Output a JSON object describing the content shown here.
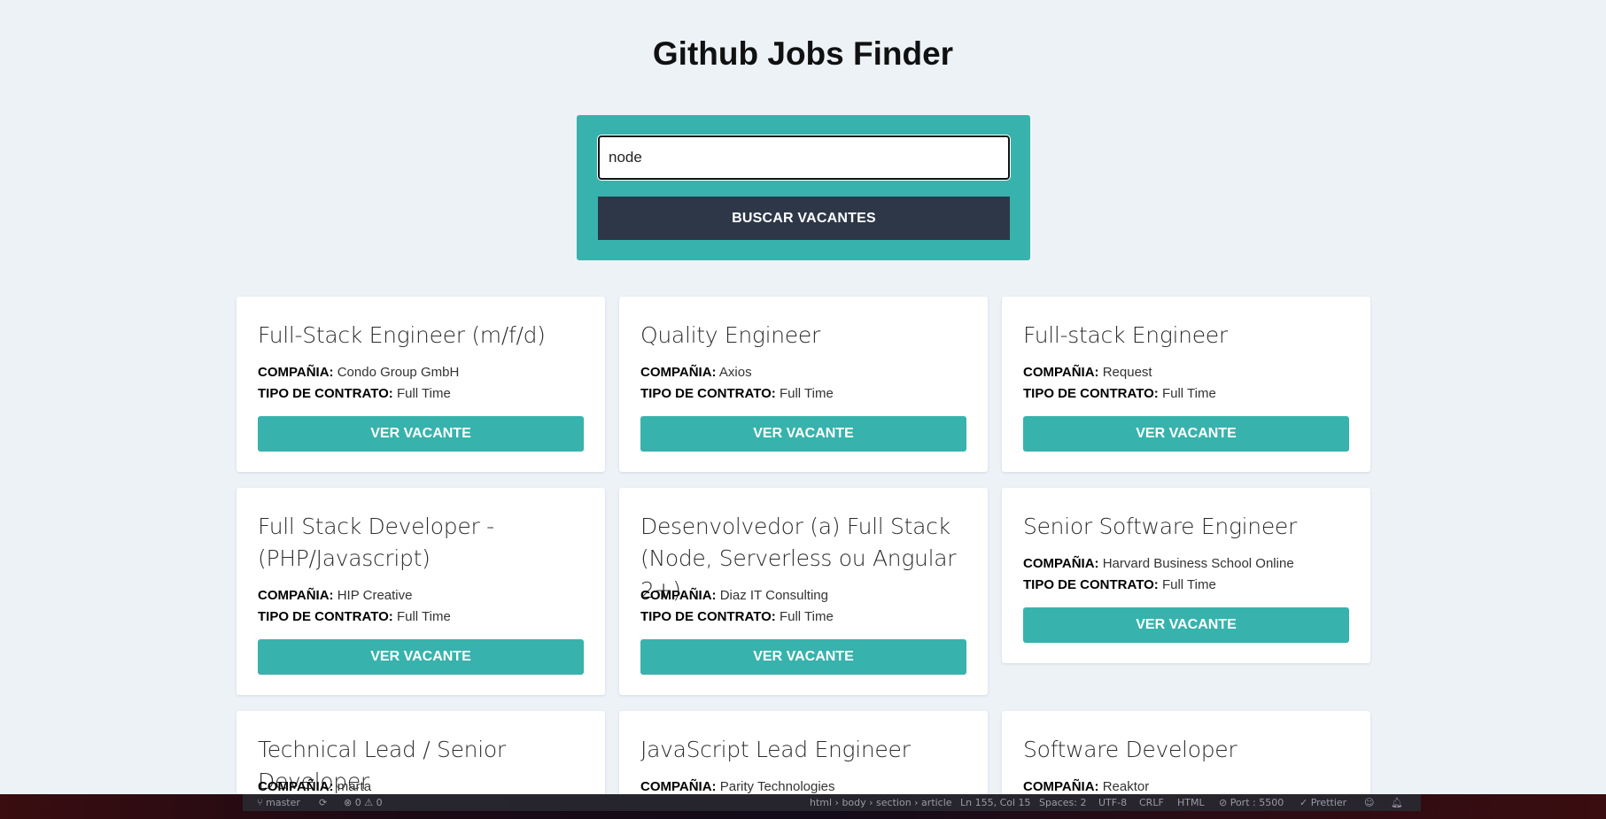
{
  "header": {
    "title": "Github Jobs Finder"
  },
  "search": {
    "value": "node",
    "button_label": "BUSCAR VACANTES"
  },
  "labels": {
    "company": "COMPAÑIA:",
    "contract": "TIPO DE CONTRATO:",
    "view": "VER VACANTE"
  },
  "jobs": [
    {
      "title": "Full-Stack Engineer (m/f/d)",
      "company": "Condo Group GmbH",
      "contract": "Full Time"
    },
    {
      "title": "Quality Engineer",
      "company": "Axios",
      "contract": "Full Time"
    },
    {
      "title": "Full-stack Engineer",
      "company": "Request",
      "contract": "Full Time"
    },
    {
      "title": "Full Stack Developer - (PHP/Javascript)",
      "company": "HIP Creative",
      "contract": "Full Time"
    },
    {
      "title": "Desenvolvedor (a) Full Stack (Node, Serverless ou Angular 2+)",
      "company": "Diaz IT Consulting",
      "contract": "Full Time"
    },
    {
      "title": "Senior Software Engineer",
      "company": "Harvard Business School Online",
      "contract": "Full Time"
    },
    {
      "title": "Technical Lead / Senior Developer",
      "company": "marta",
      "contract": ""
    },
    {
      "title": "JavaScript Lead Engineer",
      "company": "Parity Technologies",
      "contract": ""
    },
    {
      "title": "Software Developer",
      "company": "Reaktor",
      "contract": ""
    }
  ],
  "statusbar": {
    "branch": "master",
    "problems": "⊗ 0 ⚠ 0",
    "breadcrumb": "html › body › section › article",
    "position": "Ln 155, Col 15",
    "spaces": "Spaces: 2",
    "encoding": "UTF-8",
    "eol": "CRLF",
    "language": "HTML",
    "port": "⊘ Port : 5500",
    "prettier": "✓ Prettier"
  }
}
